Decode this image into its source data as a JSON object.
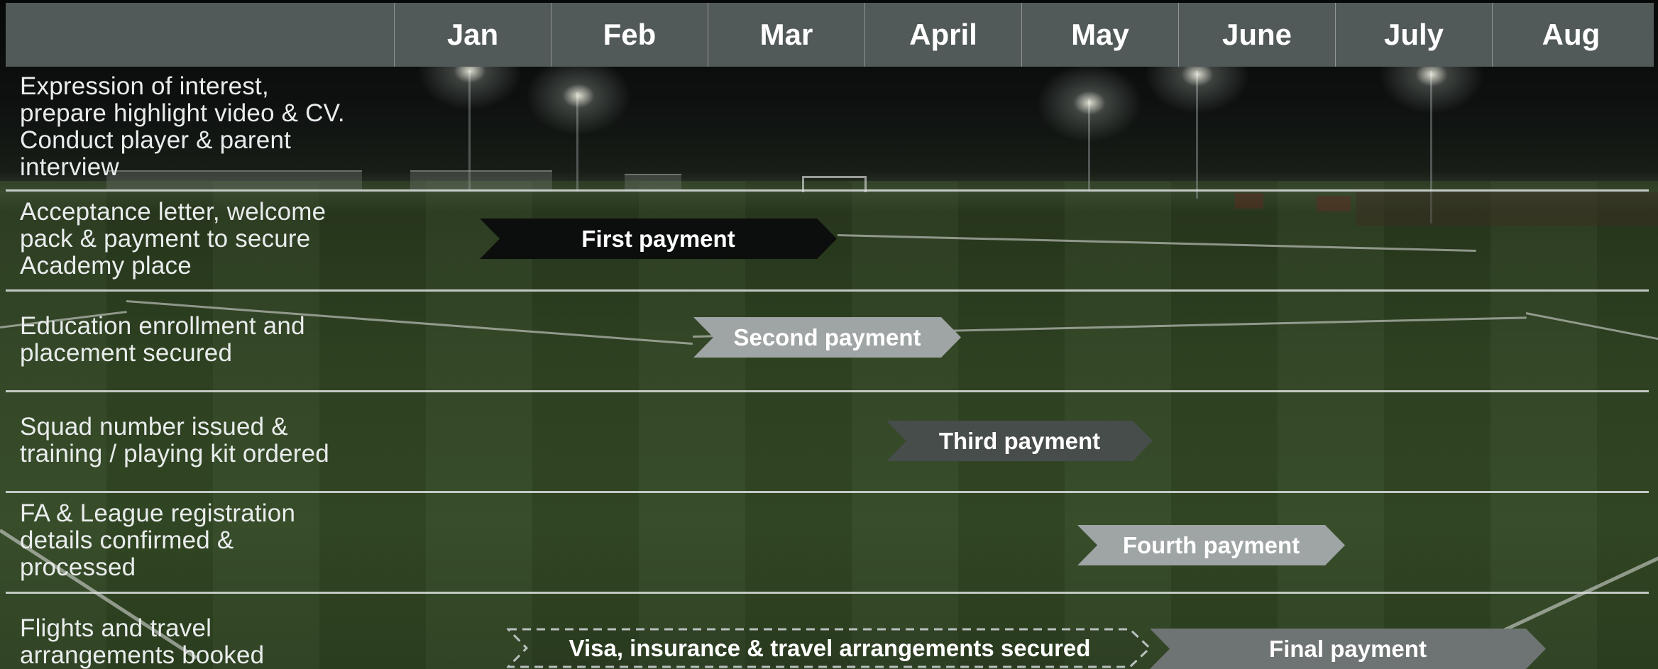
{
  "header": {
    "months": [
      "Jan",
      "Feb",
      "Mar",
      "April",
      "May",
      "June",
      "July",
      "Aug"
    ]
  },
  "rows": [
    {
      "label": "Expression of interest,\nprepare highlight video & CV.\nConduct player & parent\ninterview"
    },
    {
      "label": "Acceptance letter, welcome\npack & payment to secure\nAcademy place",
      "payment": "First payment"
    },
    {
      "label": "Education enrollment and\nplacement secured",
      "payment": "Second payment"
    },
    {
      "label": "Squad number issued &\ntraining / playing kit ordered",
      "payment": "Third payment"
    },
    {
      "label": "FA & League registration\ndetails confirmed &\nprocessed",
      "payment": "Fourth payment"
    },
    {
      "label": "Flights and travel\narrangements booked",
      "milestone": "Visa, insurance & travel arrangements secured",
      "payment": "Final payment"
    }
  ],
  "colors": {
    "header_bg": "#525a59",
    "first_payment": "#0c0e0d",
    "second_payment": "#9fa4a4",
    "third_payment": "#474d4b",
    "fourth_payment": "#9fa4a4",
    "final_payment": "#6e7473"
  }
}
